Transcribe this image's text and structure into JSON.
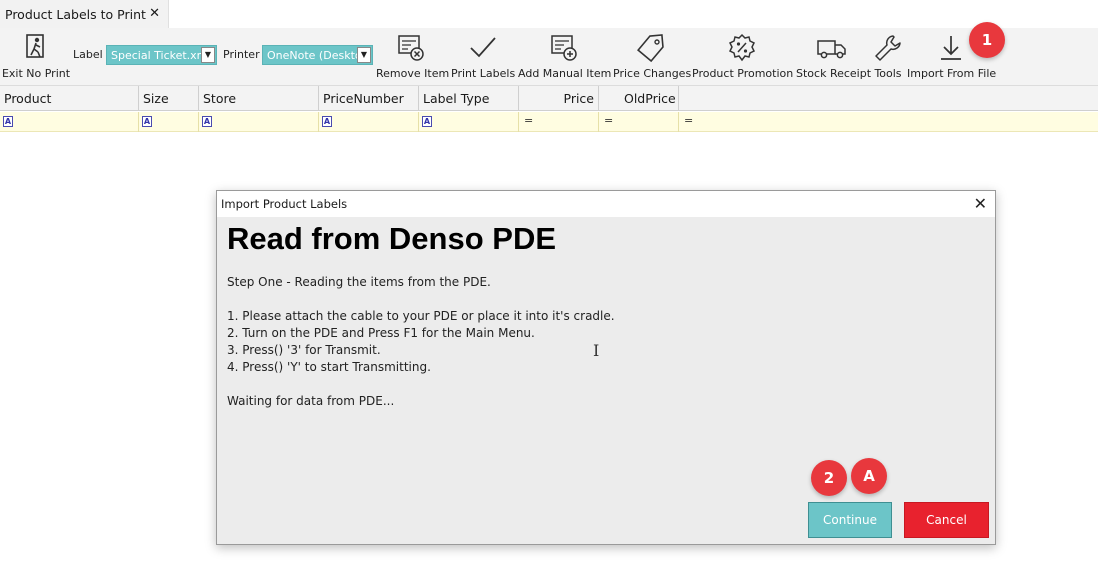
{
  "tab": {
    "title": "Product Labels to Print",
    "close": "✕"
  },
  "toolbar": {
    "exit_label": "Exit No Print",
    "label_field": "Label",
    "label_value": "Special Ticket.xml",
    "printer_field": "Printer",
    "printer_value": "OneNote (Deskto",
    "remove_item": "Remove Item",
    "print_labels": "Print Labels",
    "add_manual_item": "Add Manual Item",
    "price_changes": "Price Changes",
    "product_promotion": "Product Promotion",
    "stock_receipt": "Stock Receipt",
    "tools": "Tools",
    "import_from_file": "Import From File",
    "dropdown_arrow": "▼"
  },
  "grid": {
    "columns": [
      "Product",
      "Size",
      "Store",
      "PriceNumber",
      "Label Type",
      "Price",
      "OldPrice"
    ],
    "filter_text_icon": "A",
    "filter_equals_icon": "="
  },
  "badges": {
    "b1": "1",
    "b2": "2",
    "bA": "A"
  },
  "dialog": {
    "title": "Import Product Labels",
    "close": "✕",
    "heading": "Read from Denso PDE",
    "step": "Step One - Reading the items from the PDE.",
    "line1": "1. Please attach the cable to your PDE or place it into it's cradle.",
    "line2": "2. Turn on the PDE and Press F1 for the Main Menu.",
    "line3": "3. Press() '3' for Transmit.",
    "line4": "4. Press() 'Y' to start Transmitting.",
    "waiting": "Waiting for data from PDE...",
    "continue": "Continue",
    "cancel": "Cancel"
  },
  "colors": {
    "accent": "#6cc5c8",
    "danger": "#e8222e",
    "badge": "#e8383d",
    "filter_bg": "#fffde1"
  }
}
